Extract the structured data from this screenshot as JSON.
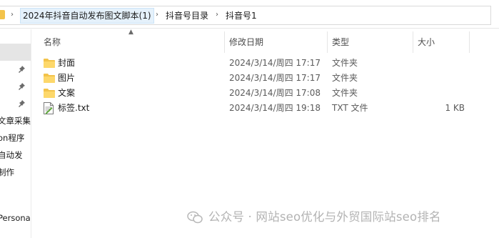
{
  "breadcrumb": {
    "items": [
      "2024年抖音自动发布图文脚本(1)",
      "抖音号目录",
      "抖音号1"
    ],
    "separator": "›"
  },
  "nav": {
    "items": [
      "文章采集",
      "on程序",
      "自动发",
      "制作",
      "Persona"
    ]
  },
  "columns": {
    "name": "名称",
    "modified": "修改日期",
    "type": "类型",
    "size": "大小"
  },
  "files": [
    {
      "name": "封面",
      "modified": "2024/3/14/周四 17:17",
      "type": "文件夹",
      "size": "",
      "icon": "folder-icon"
    },
    {
      "name": "图片",
      "modified": "2024/3/14/周四 17:17",
      "type": "文件夹",
      "size": "",
      "icon": "folder-icon"
    },
    {
      "name": "文案",
      "modified": "2024/3/14/周四 17:08",
      "type": "文件夹",
      "size": "",
      "icon": "folder-icon"
    },
    {
      "name": "标签.txt",
      "modified": "2024/3/14/周四 19:18",
      "type": "TXT 文件",
      "size": "1 KB",
      "icon": "text-file-icon"
    }
  ],
  "watermark": {
    "text": "公众号 · 网站seo优化与外贸国际站seo排名"
  },
  "colors": {
    "folder": "#f3c34b",
    "selection": "#e5f1fb",
    "header_text": "#4c4c4c"
  }
}
